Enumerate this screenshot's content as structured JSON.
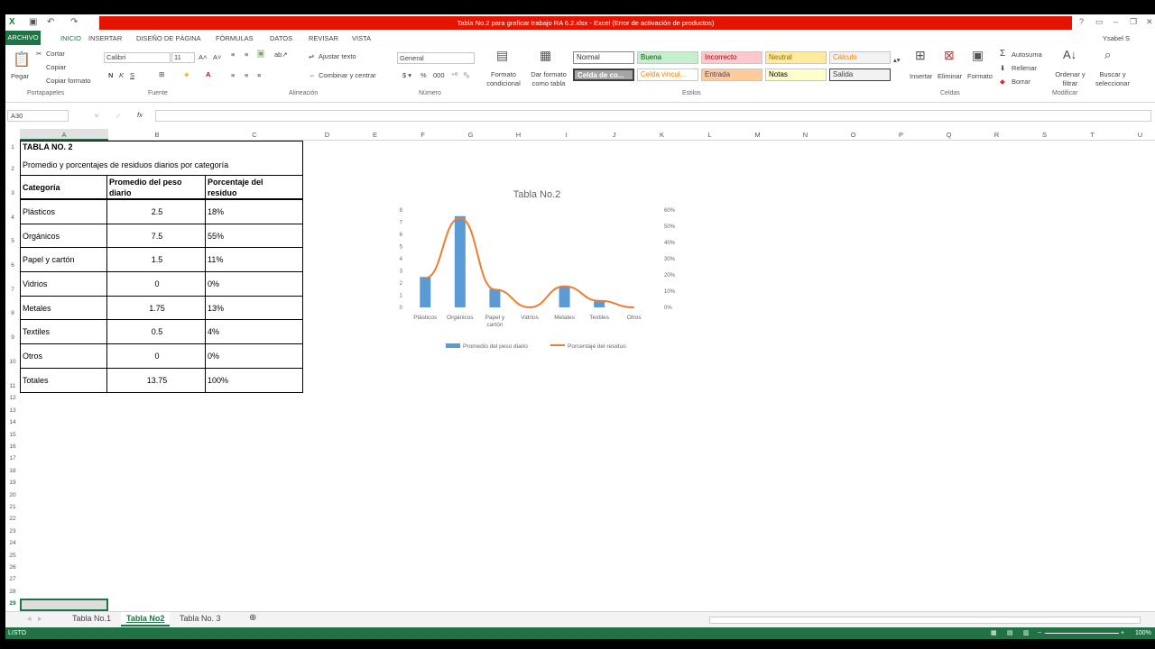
{
  "window": {
    "title": "Tabla No.2 para graficar trabajo RA 6.2.xlsx - Excel (Error de activación de productos)",
    "user": "Ysabel S"
  },
  "ribbon_tabs": [
    "ARCHIVO",
    "INICIO",
    "INSERTAR",
    "DISEÑO DE PÁGINA",
    "FÓRMULAS",
    "DATOS",
    "REVISAR",
    "VISTA"
  ],
  "clipboard": {
    "paste": "Pegar",
    "cut": "Cortar",
    "copy": "Copiar",
    "format_painter": "Copiar formato",
    "group": "Portapapeles"
  },
  "font": {
    "name": "Calibri",
    "size": "11",
    "group": "Fuente"
  },
  "alignment": {
    "wrap": "Ajustar texto",
    "merge": "Combinar y centrar",
    "group": "Alineación"
  },
  "number": {
    "format": "General",
    "group": "Número"
  },
  "styles": {
    "cond": "Formato condicional",
    "table": "Dar formato como tabla",
    "group": "Estilos",
    "cells": [
      "Normal",
      "Buena",
      "Incorrecto",
      "Neutral",
      "Cálculo",
      "Celda de co...",
      "Celda vincul...",
      "Entrada",
      "Notas",
      "Salida"
    ]
  },
  "cells_group": {
    "insert": "Insertar",
    "delete": "Eliminar",
    "format": "Formato",
    "group": "Celdas"
  },
  "editing": {
    "autosum": "Autosuma",
    "fill": "Rellenar",
    "clear": "Borrar",
    "sort": "Ordenar y filtrar",
    "find": "Buscar y seleccionar",
    "group": "Modificar"
  },
  "formula_bar": {
    "name_box": "A30",
    "fx": "fx"
  },
  "columns": [
    "A",
    "B",
    "C",
    "D",
    "E",
    "F",
    "G",
    "H",
    "I",
    "J",
    "K",
    "L",
    "M",
    "N",
    "O",
    "P",
    "Q",
    "R",
    "S",
    "T",
    "U"
  ],
  "table": {
    "title": "TABLA NO. 2",
    "subtitle": "Promedio y porcentajes de residuos diarios por categoría",
    "headers": [
      "Categoría",
      "Promedio del peso diario",
      "Porcentaje del residuo"
    ],
    "rows": [
      [
        "Plásticos",
        "2.5",
        "18%"
      ],
      [
        "Orgánicos",
        "7.5",
        "55%"
      ],
      [
        "Papel y cartón",
        "1.5",
        "11%"
      ],
      [
        "Vidrios",
        "0",
        "0%"
      ],
      [
        "Metales",
        "1.75",
        "13%"
      ],
      [
        "Textiles",
        "0.5",
        "4%"
      ],
      [
        "Otros",
        "0",
        "0%"
      ],
      [
        "Totales",
        "13.75",
        "100%"
      ]
    ]
  },
  "chart_data": {
    "type": "bar",
    "title": "Tabla No.2",
    "categories": [
      "Plásticos",
      "Orgánicos",
      "Papel y cartón",
      "Vidrios",
      "Metales",
      "Textiles",
      "Otros"
    ],
    "series": [
      {
        "name": "Promedio del peso diario",
        "type": "bar",
        "axis": "left",
        "values": [
          2.5,
          7.5,
          1.5,
          0,
          1.75,
          0.5,
          0
        ],
        "color": "#5b9bd5"
      },
      {
        "name": "Porcentaje del residuo",
        "type": "line",
        "axis": "right",
        "values": [
          18,
          55,
          11,
          0,
          13,
          4,
          0
        ],
        "color": "#ed7d31"
      }
    ],
    "ylim": [
      0,
      8
    ],
    "y2lim": [
      0,
      60
    ],
    "yticks": [
      "0",
      "1",
      "2",
      "3",
      "4",
      "5",
      "6",
      "7",
      "8"
    ],
    "y2ticks": [
      "0%",
      "10%",
      "20%",
      "30%",
      "40%",
      "50%",
      "60%"
    ],
    "legend": "bottom"
  },
  "sheets": [
    "Tabla No.1",
    "Tabla No2",
    "Tabla No. 3"
  ],
  "status": {
    "mode": "LISTO",
    "zoom": "100%"
  }
}
